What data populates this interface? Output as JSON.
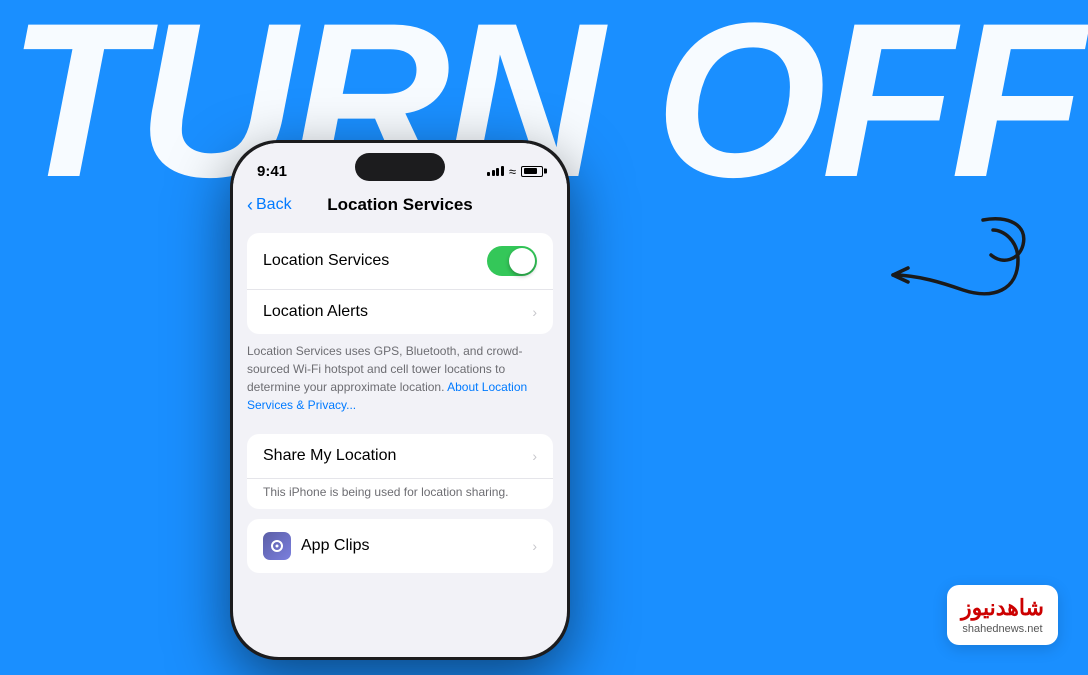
{
  "background": {
    "color": "#1a8fff"
  },
  "headline": {
    "text": "TURN OFF"
  },
  "phone": {
    "status_bar": {
      "time": "9:41"
    },
    "nav": {
      "back_label": "Back",
      "title": "Location Services"
    },
    "location_services_row": {
      "label": "Location Services",
      "toggle_on": true
    },
    "location_alerts_row": {
      "label": "Location Alerts"
    },
    "description": {
      "text": "Location Services uses GPS, Bluetooth, and crowd-sourced Wi-Fi hotspot and cell tower locations to determine your approximate location.",
      "link_text": "About Location Services & Privacy..."
    },
    "share_my_location": {
      "label": "Share My Location",
      "subtitle": "This iPhone is being used for location sharing."
    },
    "app_clips": {
      "label": "App Clips"
    }
  },
  "logo": {
    "main": "شاهدنیوز",
    "sub": "shahednews.net"
  }
}
